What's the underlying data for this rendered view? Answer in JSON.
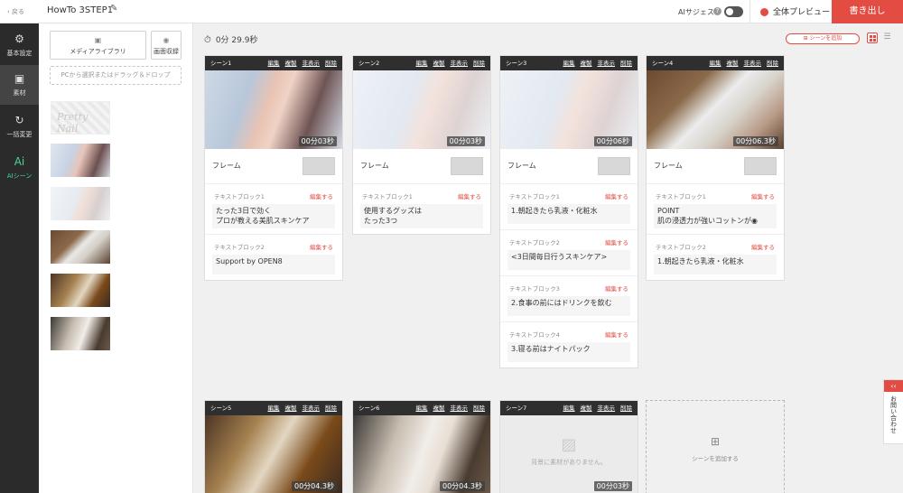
{
  "header": {
    "back": "‹ 戻る",
    "project_title": "HowTo 3STEP1",
    "ai_suggest": "AIサジェスト",
    "help": "?",
    "preview": "全体プレビュー",
    "export": "書き出し"
  },
  "nav": {
    "items": [
      {
        "label": "基本設定",
        "icon": "gear-icon",
        "glyph": "⚙"
      },
      {
        "label": "素材",
        "icon": "image-icon",
        "glyph": "▣"
      },
      {
        "label": "一括変更",
        "icon": "refresh-icon",
        "glyph": "↻"
      },
      {
        "label": "AIシーン",
        "icon": "ai-icon",
        "glyph": "Ai"
      }
    ]
  },
  "panel": {
    "media_library": "メディアライブラリ",
    "screen_record": "画面収録",
    "drop_hint": "PCから選択またはドラッグ＆ドロップ",
    "thumb0_text": "Pretty Nail"
  },
  "main": {
    "timer": "0分 29.9秒",
    "add_scene": "シーンを追加",
    "add_scene_card": "シーンを追加する",
    "no_media": "背景に素材がありません。"
  },
  "labels": {
    "frame": "フレーム",
    "edit": "編集する",
    "a_edit": "編集",
    "a_copy": "複製",
    "a_hide": "非表示",
    "a_del": "削除"
  },
  "scenes": [
    {
      "title": "シーン1",
      "duration": "00分03秒",
      "blocks": [
        {
          "label": "テキストブロック1",
          "text": "たった3日で効く\nプロが教える美肌スキンケア"
        },
        {
          "label": "テキストブロック2",
          "text": "Support by OPEN8"
        }
      ]
    },
    {
      "title": "シーン2",
      "duration": "00分03秒",
      "blocks": [
        {
          "label": "テキストブロック1",
          "text": "使用するグッズは\nたった3つ"
        }
      ]
    },
    {
      "title": "シーン3",
      "duration": "00分06秒",
      "blocks": [
        {
          "label": "テキストブロック1",
          "text": "1.朝起きたら乳液・化粧水"
        },
        {
          "label": "テキストブロック2",
          "text": "<3日間毎日行うスキンケア>"
        },
        {
          "label": "テキストブロック3",
          "text": "2.食事の前にはドリンクを飲む"
        },
        {
          "label": "テキストブロック4",
          "text": "3.寝る前はナイトパック"
        }
      ]
    },
    {
      "title": "シーン4",
      "duration": "00分06.3秒",
      "blocks": [
        {
          "label": "テキストブロック1",
          "text": "POINT\n肌の浸透力が強いコットンが◉"
        },
        {
          "label": "テキストブロック2",
          "text": "1.朝起きたら乳液・化粧水"
        }
      ]
    },
    {
      "title": "シーン5",
      "duration": "00分04.3秒"
    },
    {
      "title": "シーン6",
      "duration": "00分04.3秒"
    },
    {
      "title": "シーン7",
      "duration": "00分03秒"
    }
  ],
  "contact": {
    "tab": "‹‹",
    "label": "お問い合わせ"
  }
}
